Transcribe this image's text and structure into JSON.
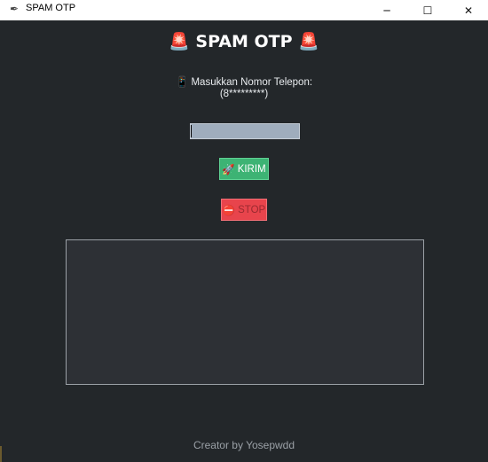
{
  "window": {
    "title": "SPAM OTP",
    "minimize": "─",
    "maximize": "☐",
    "close": "✕"
  },
  "app": {
    "heading": "🚨 SPAM OTP 🚨",
    "prompt_line1": "📱 Masukkan Nomor Telepon:",
    "prompt_line2": "(8*********)",
    "phone_value": "",
    "send_icon": "🚀",
    "send_label": "KIRIM",
    "stop_icon": "⛔",
    "stop_label": "STOP",
    "log_text": "",
    "footer": "Creator by Yosepwdd"
  },
  "colors": {
    "background": "#23272a",
    "send": "#3db374",
    "stop": "#e8444c",
    "input": "#9fadbd"
  }
}
